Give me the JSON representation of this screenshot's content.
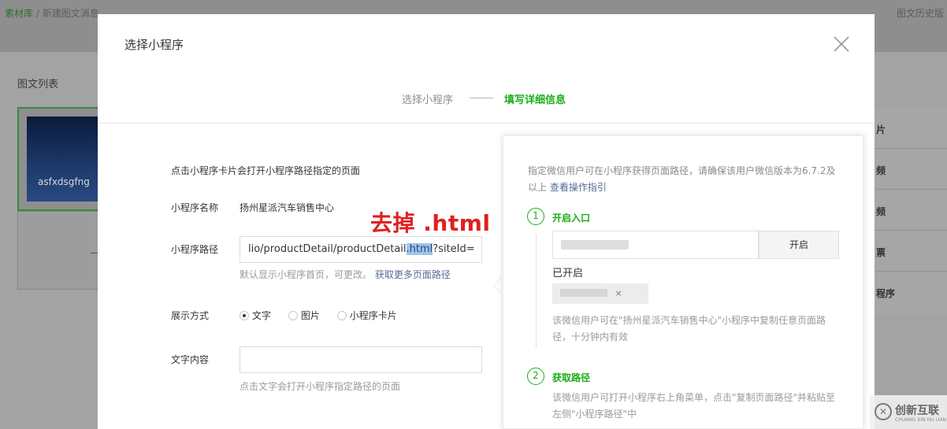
{
  "background": {
    "breadcrumb": {
      "root": "素材库",
      "separator": "/",
      "current": "新建图文消息"
    },
    "top_right": "图文历史版",
    "list_title": "图文列表",
    "card_text": "asfxdsgfng",
    "side_items": [
      "片",
      "频",
      "频",
      "票",
      "程序"
    ]
  },
  "modal": {
    "title": "选择小程序",
    "steps": {
      "step1": "选择小程序",
      "step2": "填写详细信息"
    },
    "intro": "点击小程序卡片会打开小程序路径指定的页面",
    "name_label": "小程序名称",
    "name_value": "扬州星派汽车销售中心",
    "path_label": "小程序路径",
    "path_value_before": "lio/productDetail/productDetail",
    "path_value_highlight": ".html",
    "path_value_after": "?siteId=",
    "annotation": "去掉 .html",
    "path_hint": "默认显示小程序首页，可更改。",
    "path_hint_link": "获取更多页面路径",
    "display_label": "展示方式",
    "display_options": [
      "文字",
      "图片",
      "小程序卡片"
    ],
    "display_selected": "文字",
    "text_label": "文字内容",
    "text_value": "",
    "text_hint": "点击文字会打开小程序指定路径的页面"
  },
  "panel": {
    "desc": "指定微信用户可在小程序获得页面路径，请确保该用户微信版本为6.7.2及以上",
    "desc_link": "查看操作指引",
    "step1_num": "1",
    "step1_title": "开启入口",
    "open_button": "开启",
    "opened_label": "已开启",
    "tag_close": "×",
    "step1_note": "该微信用户可在\"扬州星派汽车销售中心\"小程序中复制任意页面路径，十分钟内有效",
    "step2_num": "2",
    "step2_title": "获取路径",
    "step2_note": "该微信用户可打开小程序右上角菜单，点击\"复制页面路径\"并粘贴至左侧\"小程序路径\"中"
  },
  "watermark": {
    "text": "创新互联",
    "sub": "CHUANG XIN HU LIAN"
  },
  "colors": {
    "accent": "#1aad19",
    "link": "#576b95",
    "annotation": "#e02020",
    "highlight": "#9fc3ea"
  }
}
